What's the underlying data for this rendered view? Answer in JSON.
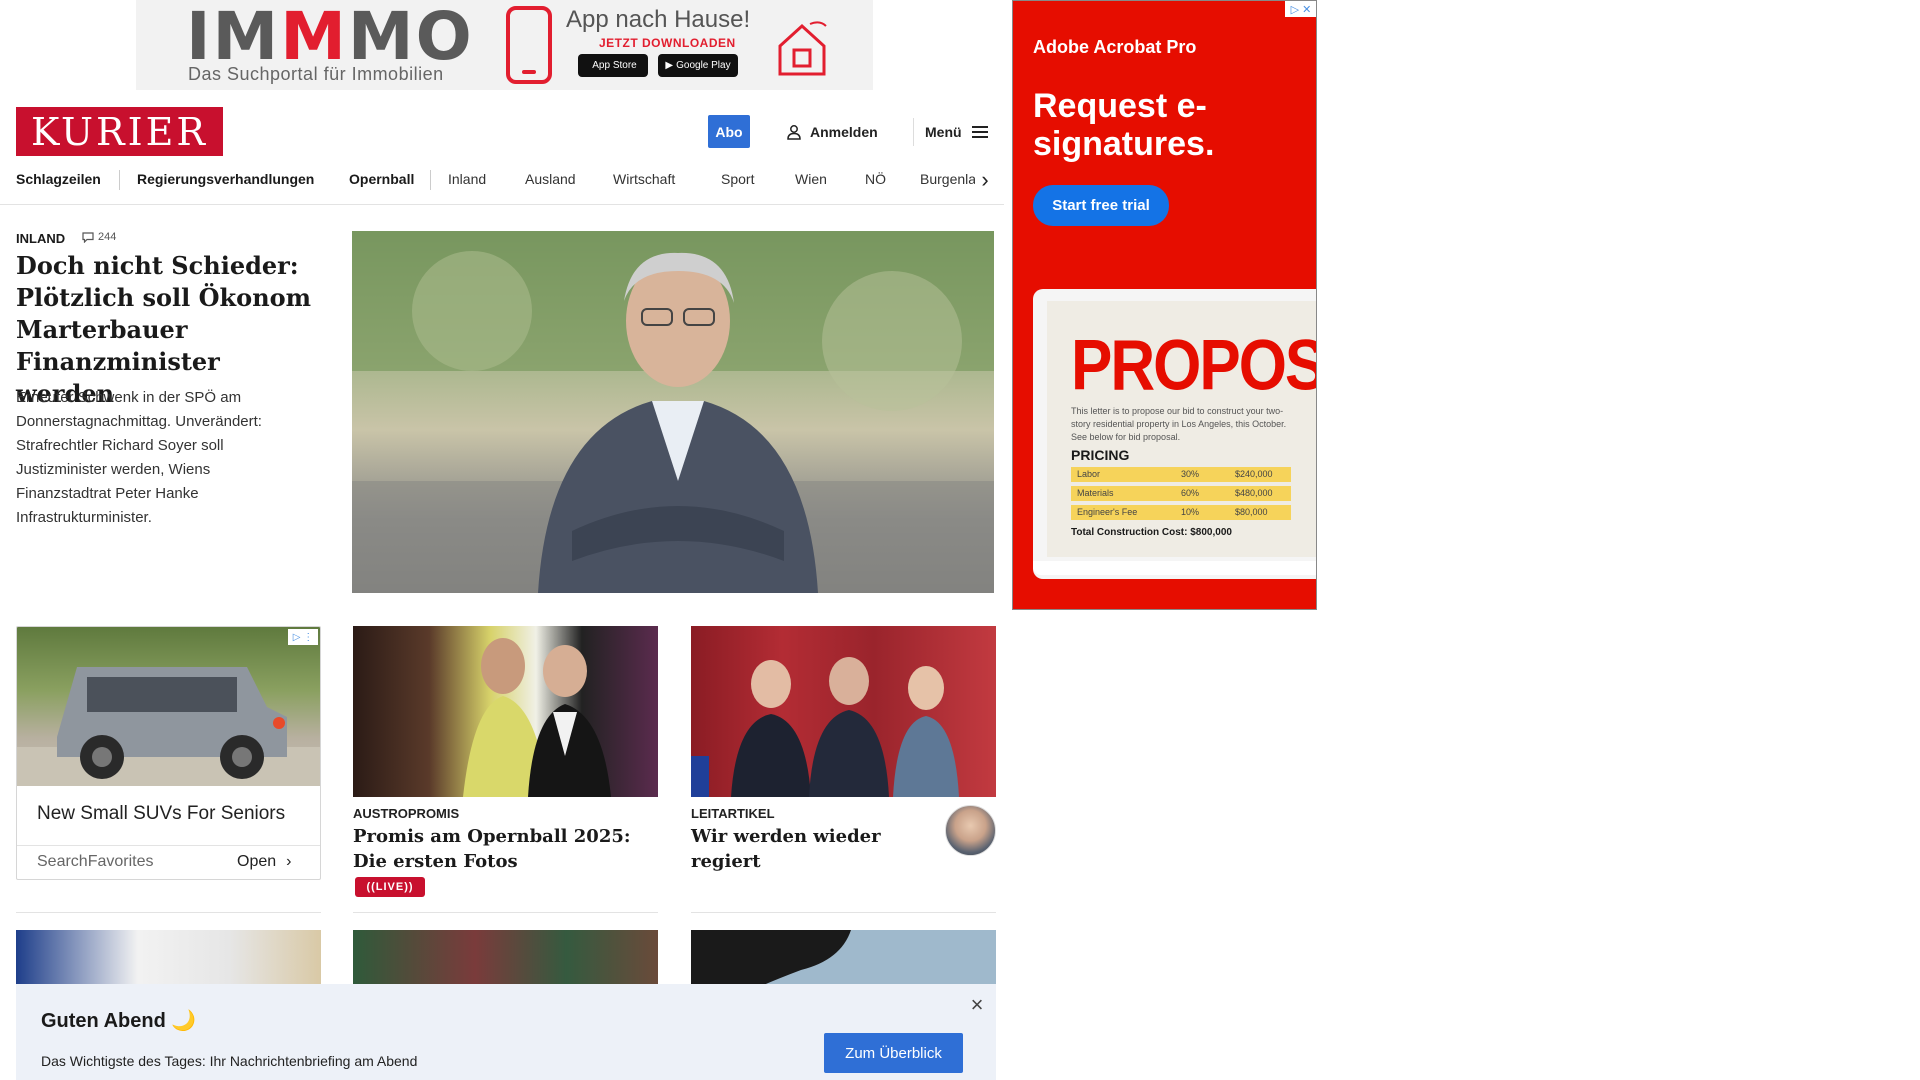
{
  "top_ad": {
    "logo": "IMMMO",
    "logo_prefix": "IM",
    "logo_accent": "M",
    "logo_suffix": "MO",
    "tagline": "Das Suchportal für Immobilien",
    "title": "App nach Hause!",
    "cta": "JETZT DOWNLOADEN",
    "appstore": "App Store",
    "googleplay": "Google Play",
    "accent_color": "#e21e2f"
  },
  "header": {
    "logo": "KURIER",
    "abo_label": "Abo",
    "login_label": "Anmelden",
    "menu_label": "Menü",
    "brand_color": "#c8102e",
    "accent_color": "#2f6fd6"
  },
  "nav": {
    "items": [
      "Schlagzeilen",
      "Regierungsverhandlungen",
      "Opernball",
      "Inland",
      "Ausland",
      "Wirtschaft",
      "Sport",
      "Wien",
      "NÖ",
      "Burgenla"
    ]
  },
  "lead": {
    "section": "INLAND",
    "comments": "244",
    "title": "Doch nicht Schieder: Plötzlich soll Ökonom Marterbauer Finanzminister werden",
    "teaser": "Erneuter Schwenk in der SPÖ am Donnerstagnachmittag. Unverändert: Strafrechtler Richard Soyer soll Justizminister werden, Wiens Finanzstadtrat Peter Hanke Infrastrukturminister."
  },
  "ad_card": {
    "title": "New Small SUVs For Seniors",
    "source": "SearchFavorites",
    "open_label": "Open"
  },
  "cards": [
    {
      "kicker": "AUSTROPROMIS",
      "title": "Promis am Opernball 2025: Die ersten Fotos",
      "badge": "LIVE"
    },
    {
      "kicker": "LEITARTIKEL",
      "title": "Wir werden wieder regiert"
    }
  ],
  "briefing": {
    "title": "Guten Abend 🌙",
    "text": "Das Wichtigste des Tages: Ihr Nachrichtenbriefing am Abend",
    "cta": "Zum Überblick"
  },
  "sky_ad": {
    "brand": "Adobe Acrobat Pro",
    "headline": "Request e-signatures.",
    "cta": "Start free trial",
    "doc_title": "PROPOSAL",
    "doc_body": "This letter is to propose our bid to construct your two-story residential property in Los Angeles, this October. See below for bid proposal.",
    "pricing_label": "PRICING",
    "pricing_rows": [
      {
        "item": "Labor",
        "pct": "30%",
        "amount": "$240,000"
      },
      {
        "item": "Materials",
        "pct": "60%",
        "amount": "$480,000"
      },
      {
        "item": "Engineer's Fee",
        "pct": "10%",
        "amount": "$80,000"
      }
    ],
    "total": "Total Construction Cost: $800,000",
    "background_color": "#e60d00"
  }
}
